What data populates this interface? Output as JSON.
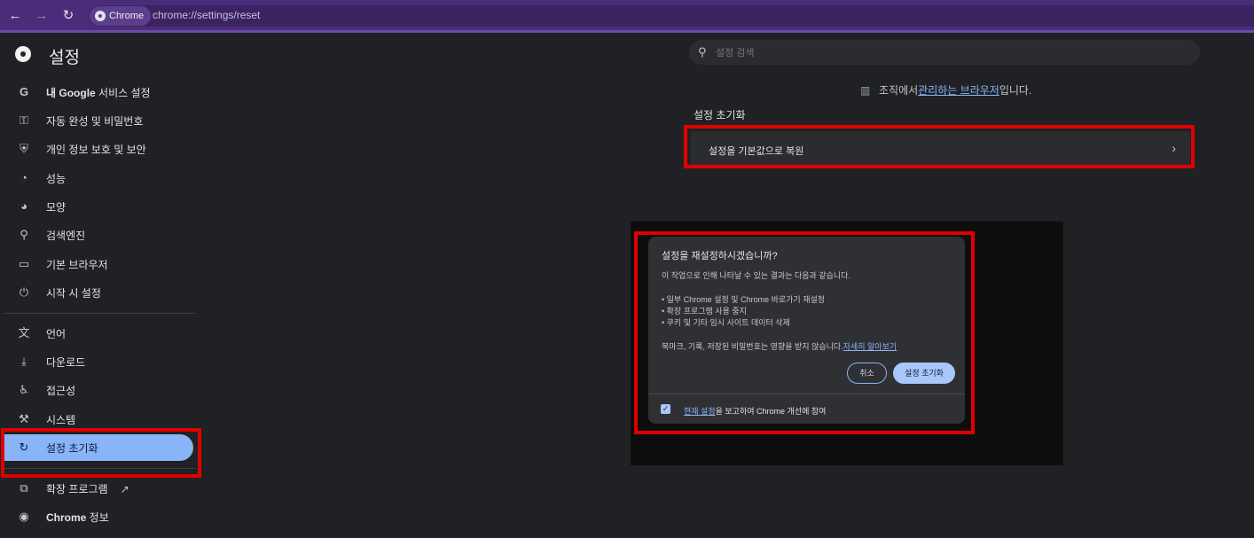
{
  "browser": {
    "chip_label": "Chrome",
    "url": "chrome://settings/reset"
  },
  "sidebar": {
    "title": "설정",
    "items": [
      {
        "label_bold": "내 Google",
        "label": " 서비스 설정",
        "icon": "google-icon"
      },
      {
        "label": "자동 완성 및 비밀번호",
        "icon": "key-icon"
      },
      {
        "label": "개인 정보 보호 및 보안",
        "icon": "shield-icon"
      },
      {
        "label": "성능",
        "icon": "speedometer-icon"
      },
      {
        "label": "모양",
        "icon": "palette-icon"
      },
      {
        "label": "검색엔진",
        "icon": "search-icon"
      },
      {
        "label": "기본 브라우저",
        "icon": "browser-window-icon"
      },
      {
        "label": "시작 시 설정",
        "icon": "power-icon"
      },
      {
        "label": "언어",
        "icon": "translate-icon"
      },
      {
        "label": "다운로드",
        "icon": "download-icon"
      },
      {
        "label": "접근성",
        "icon": "accessibility-icon"
      },
      {
        "label": "시스템",
        "icon": "wrench-icon"
      },
      {
        "label": "설정 초기화",
        "icon": "reset-icon",
        "active": true
      },
      {
        "label": "확장 프로그램",
        "icon": "puzzle-icon"
      },
      {
        "label_bold": "Chrome",
        "label": " 정보",
        "icon": "chrome-icon"
      }
    ]
  },
  "search": {
    "placeholder": "설정 검색"
  },
  "managed": {
    "prefix": "조직에서 ",
    "link": "관리하는 브라우저",
    "suffix": "입니다."
  },
  "reset_section": {
    "title": "설정 초기화",
    "row_label": "설정을 기본값으로 복원"
  },
  "dialog": {
    "title": "설정을 재설정하시겠습니까?",
    "intro": "이 작업으로 인해 나타날 수 있는 결과는 다음과 같습니다.",
    "bullets": [
      "• 일부 Chrome 설정 및 Chrome 바로가기 재설정",
      "• 확장 프로그램 사용 중지",
      "• 쿠키 및 기타 임시 사이트 데이터 삭제"
    ],
    "note": "북마크, 기록, 저장된 비밀번호는 영향을 받지 않습니다.",
    "learn_more": "자세히 알아보기",
    "cancel": "취소",
    "confirm": "설정 초기화",
    "checkbox_link": "현재 설정",
    "checkbox_text": "을 보고하여 Chrome 개선에 참여",
    "checkbox_checked": true
  },
  "colors": {
    "accent": "#8ab4f8",
    "highlight": "#e00000",
    "titlebar": "#4a2c7a"
  }
}
